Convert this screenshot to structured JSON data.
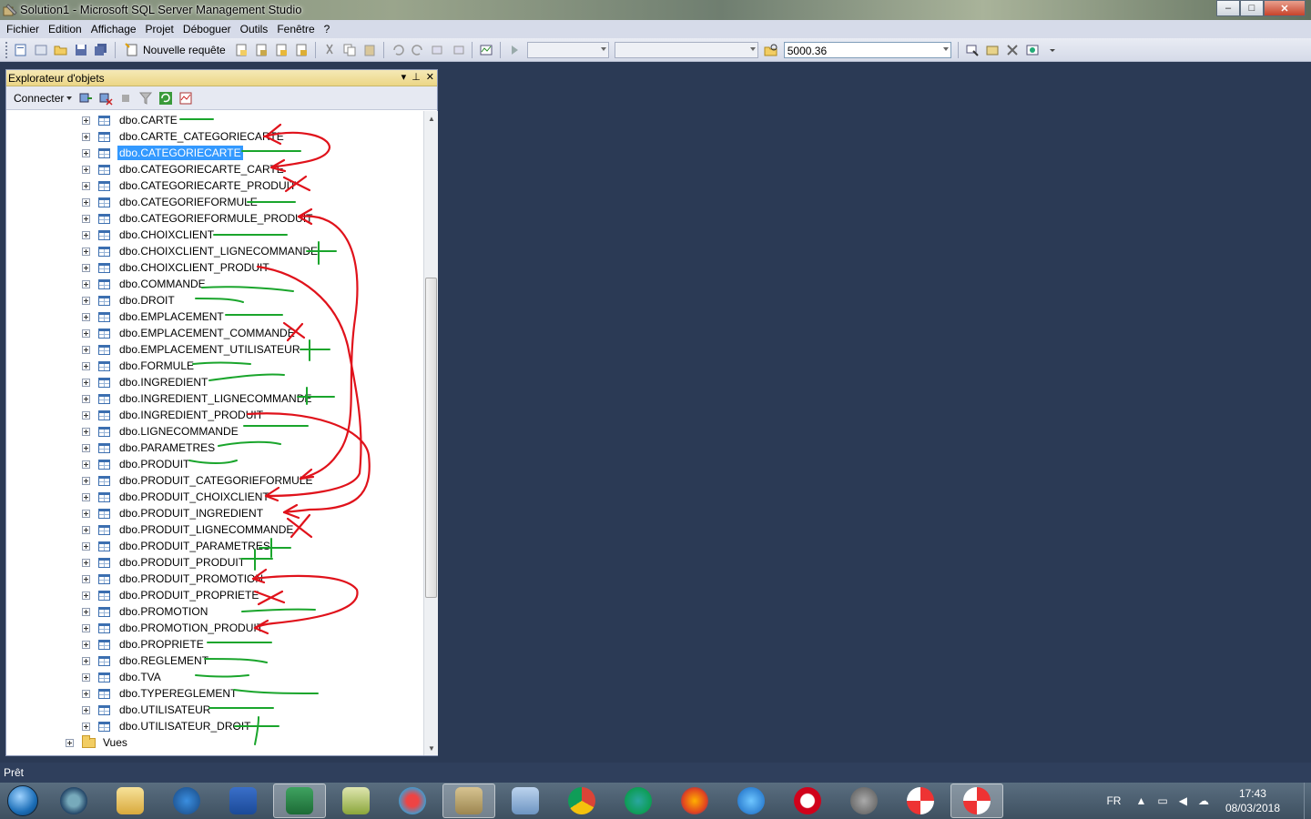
{
  "window": {
    "title": "Solution1 - Microsoft SQL Server Management Studio",
    "controls": [
      "–",
      "□",
      "✕"
    ]
  },
  "menu": [
    "Fichier",
    "Edition",
    "Affichage",
    "Projet",
    "Déboguer",
    "Outils",
    "Fenêtre",
    "?"
  ],
  "toolbar": {
    "new_query_label": "Nouvelle requête",
    "search_value": "5000.36"
  },
  "object_explorer": {
    "title": "Explorateur d'objets",
    "connect_label": "Connecter",
    "tables": [
      "dbo.CARTE",
      "dbo.CARTE_CATEGORIECARTE",
      "dbo.CATEGORIECARTE",
      "dbo.CATEGORIECARTE_CARTE",
      "dbo.CATEGORIECARTE_PRODUIT",
      "dbo.CATEGORIEFORMULE",
      "dbo.CATEGORIEFORMULE_PRODUIT",
      "dbo.CHOIXCLIENT",
      "dbo.CHOIXCLIENT_LIGNECOMMANDE",
      "dbo.CHOIXCLIENT_PRODUIT",
      "dbo.COMMANDE",
      "dbo.DROIT",
      "dbo.EMPLACEMENT",
      "dbo.EMPLACEMENT_COMMANDE",
      "dbo.EMPLACEMENT_UTILISATEUR",
      "dbo.FORMULE",
      "dbo.INGREDIENT",
      "dbo.INGREDIENT_LIGNECOMMANDE",
      "dbo.INGREDIENT_PRODUIT",
      "dbo.LIGNECOMMANDE",
      "dbo.PARAMETRES",
      "dbo.PRODUIT",
      "dbo.PRODUIT_CATEGORIEFORMULE",
      "dbo.PRODUIT_CHOIXCLIENT",
      "dbo.PRODUIT_INGREDIENT",
      "dbo.PRODUIT_LIGNECOMMANDE",
      "dbo.PRODUIT_PARAMETRES",
      "dbo.PRODUIT_PRODUIT",
      "dbo.PRODUIT_PROMOTION",
      "dbo.PRODUIT_PROPRIETE",
      "dbo.PROMOTION",
      "dbo.PROMOTION_PRODUIT",
      "dbo.PROPRIETE",
      "dbo.REGLEMENT",
      "dbo.TVA",
      "dbo.TYPEREGLEMENT",
      "dbo.UTILISATEUR",
      "dbo.UTILISATEUR_DROIT"
    ],
    "selected_table": "dbo.CATEGORIECARTE",
    "folder_label": "Vues"
  },
  "status": {
    "text": "Prêt"
  },
  "taskbar": {
    "lang": "FR",
    "time": "17:43",
    "date": "08/03/2018"
  },
  "colors": {
    "workspace": "#2b3a55",
    "annotation_red": "#e0121b",
    "annotation_green": "#1aa52c",
    "selection": "#3399ff"
  }
}
